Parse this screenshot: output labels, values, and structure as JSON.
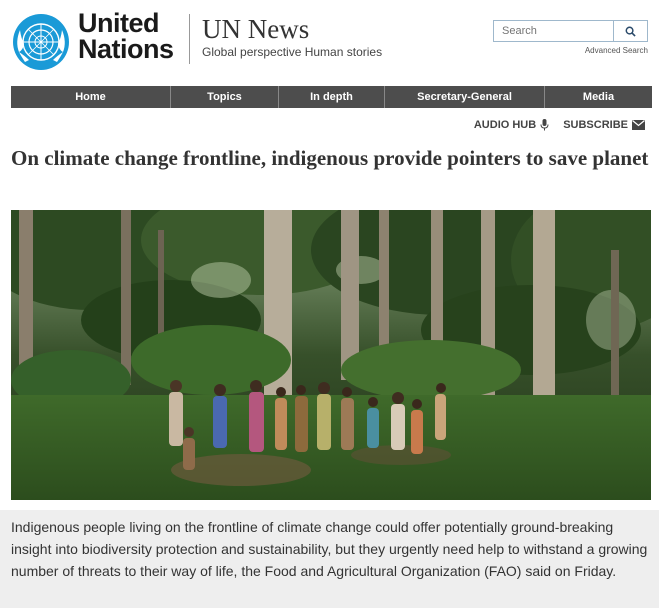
{
  "header": {
    "org_name": "United Nations",
    "org_line1": "United",
    "org_line2": "Nations",
    "site_title": "UN News",
    "tagline": "Global perspective Human stories",
    "search_placeholder": "Search",
    "search_icon": "search-icon",
    "advanced_search": "Advanced Search"
  },
  "nav": {
    "items": [
      {
        "label": "Home"
      },
      {
        "label": "Topics"
      },
      {
        "label": "In depth"
      },
      {
        "label": "Secretary-General"
      },
      {
        "label": "Media"
      }
    ]
  },
  "utility": {
    "audio_hub": "AUDIO HUB",
    "audio_icon": "microphone-icon",
    "subscribe": "SUBSCRIBE",
    "subscribe_icon": "envelope-icon"
  },
  "article": {
    "headline": "On climate change frontline, indigenous provide pointers to save planet",
    "lead": "Indigenous people living on the frontline of climate change could offer potentially ground-breaking insight into biodiversity protection and sustainability, but they urgently need help to withstand a growing number of threats to their way of life, the Food and Agricultural Organization (FAO) said on Friday."
  },
  "colors": {
    "un_blue": "#009edb",
    "nav_bg": "#4d4d4d",
    "lead_bg": "#eeeeee"
  }
}
